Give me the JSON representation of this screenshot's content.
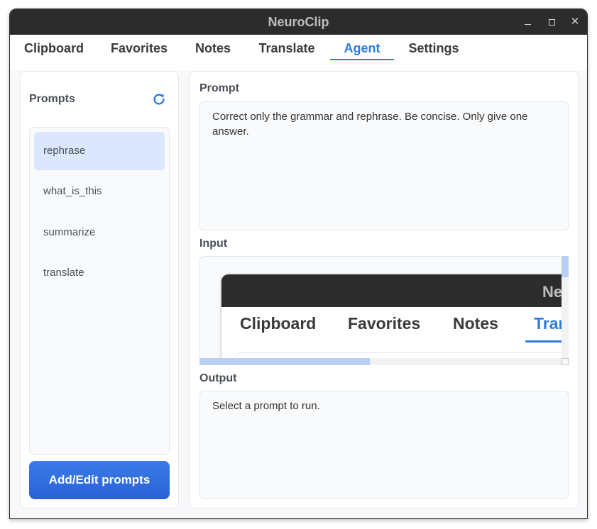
{
  "window": {
    "title": "NeuroClip"
  },
  "tabs": [
    {
      "label": "Clipboard"
    },
    {
      "label": "Favorites"
    },
    {
      "label": "Notes"
    },
    {
      "label": "Translate"
    },
    {
      "label": "Agent"
    },
    {
      "label": "Settings"
    }
  ],
  "active_tab": "Agent",
  "sidebar": {
    "heading": "Prompts",
    "prompts": [
      {
        "label": "rephrase"
      },
      {
        "label": "what_is_this"
      },
      {
        "label": "summarize"
      },
      {
        "label": "translate"
      }
    ],
    "selected": "rephrase",
    "add_button": "Add/Edit prompts"
  },
  "main": {
    "prompt_label": "Prompt",
    "prompt_text": "Correct only the grammar and rephrase. Be concise. Only give one answer.",
    "input_label": "Input",
    "input_image": {
      "window_title": "Ne",
      "tabs": [
        "Clipboard",
        "Favorites",
        "Notes",
        "Tran"
      ]
    },
    "output_label": "Output",
    "output_text": "Select a prompt to run."
  },
  "colors": {
    "accent": "#2d7be3",
    "selected_bg": "#dbe7fd",
    "titlebar": "#2c2c2c"
  }
}
